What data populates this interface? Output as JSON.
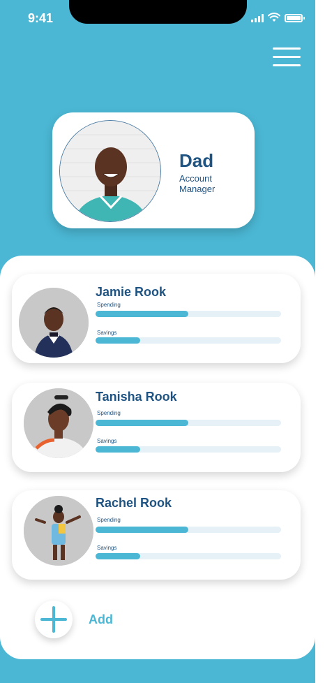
{
  "status_bar": {
    "time": "9:41"
  },
  "colors": {
    "accent": "#4bb7d4",
    "text_dark": "#1f5382",
    "track": "#e6f0f7"
  },
  "parent": {
    "name": "Dad",
    "role": "Account Manager",
    "avatar_icon": "person-avatar-icon"
  },
  "children": [
    {
      "name": "Jamie Rook",
      "spending_label": "Spending",
      "savings_label": "Savings",
      "spending_pct": 50,
      "savings_pct": 24
    },
    {
      "name": "Tanisha Rook",
      "spending_label": "Spending",
      "savings_label": "Savings",
      "spending_pct": 50,
      "savings_pct": 24
    },
    {
      "name": "Rachel Rook",
      "spending_label": "Spending",
      "savings_label": "Savings",
      "spending_pct": 50,
      "savings_pct": 24
    }
  ],
  "add": {
    "label": "Add"
  }
}
